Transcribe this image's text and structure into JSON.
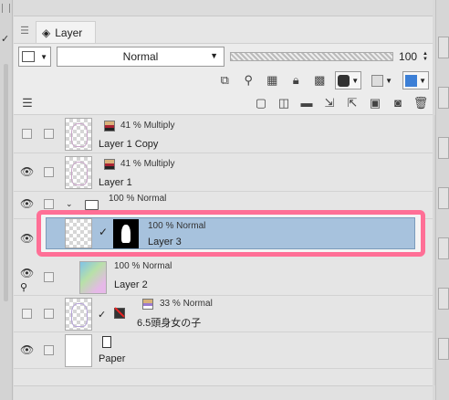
{
  "panel": {
    "tab_label": "Layer",
    "tab_menu_icon": "menu-lines-icon",
    "layer_icon": "layers-icon"
  },
  "toolbar": {
    "blend_mode": "Normal",
    "opacity": "100",
    "highlight_color": "#ff6f96",
    "selection_color": "#a7c2dd"
  },
  "layers": [
    {
      "mode": "41 % Multiply",
      "name": "Layer 1 Copy",
      "visible": false
    },
    {
      "mode": "41 % Multiply",
      "name": "Layer 1",
      "visible": true
    },
    {
      "mode": "100 % Normal",
      "name": "",
      "type": "folder",
      "visible": true
    },
    {
      "mode": "100 % Normal",
      "name": "Layer 3",
      "visible": true,
      "selected": true
    },
    {
      "mode": "100 % Normal",
      "name": "Layer 2",
      "visible": true
    },
    {
      "mode": "33 % Normal",
      "name": "6.5頭身女の子",
      "visible": true
    },
    {
      "mode": "",
      "name": "Paper",
      "visible": true
    }
  ]
}
